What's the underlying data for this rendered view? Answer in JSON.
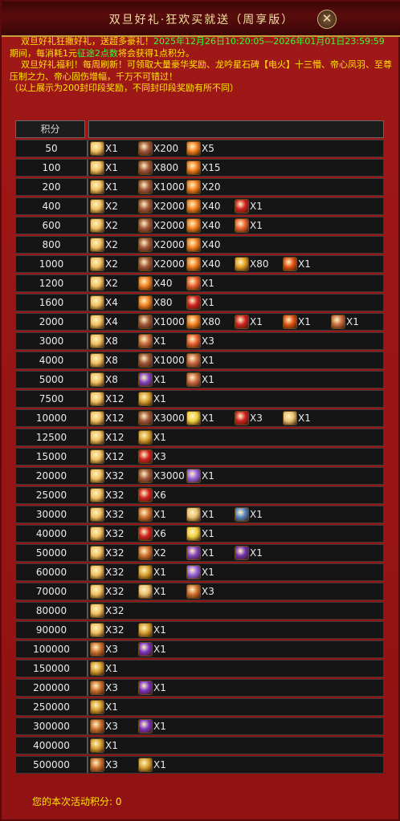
{
  "title": "双旦好礼·狂欢买就送（周享版）",
  "close_label": "✕",
  "description": {
    "line1_a": "双旦好礼狂撒好礼，送超多豪礼！",
    "line1_b": "2025年12月26日10:20:05—2026年01月01日23:59:59",
    "line2_a": "期间，每消耗1元",
    "line2_b": "征途2点数",
    "line2_c": "将会获得1点积分。",
    "line3": "双旦好礼福利！每周刷新！可领取大量豪华奖励、龙吟星石碑【电火】十三懵、帝心凤羽、至尊压制之力、帝心固伤增幅，千万不可错过！",
    "line4": "（以上展示为200封印段奖励，不同封印段奖励有所不同）"
  },
  "table": {
    "header": "积分",
    "rows": [
      {
        "score": "50",
        "items": [
          {
            "icon": "ticket-icon",
            "qty": "X1"
          },
          {
            "icon": "stone-icon",
            "qty": "X200"
          },
          {
            "icon": "feather-icon",
            "qty": "X5"
          }
        ]
      },
      {
        "score": "100",
        "items": [
          {
            "icon": "ticket-icon",
            "qty": "X1"
          },
          {
            "icon": "stone-icon",
            "qty": "X800"
          },
          {
            "icon": "feather-icon",
            "qty": "X15"
          }
        ]
      },
      {
        "score": "200",
        "items": [
          {
            "icon": "ticket-icon",
            "qty": "X1"
          },
          {
            "icon": "stone-icon",
            "qty": "X1000"
          },
          {
            "icon": "feather-icon",
            "qty": "X20"
          }
        ]
      },
      {
        "score": "400",
        "items": [
          {
            "icon": "ticket-icon",
            "qty": "X2"
          },
          {
            "icon": "stone-icon",
            "qty": "X2000"
          },
          {
            "icon": "feather-icon",
            "qty": "X40"
          },
          {
            "icon": "red-box-icon",
            "qty": "X1"
          }
        ]
      },
      {
        "score": "600",
        "items": [
          {
            "icon": "ticket-icon",
            "qty": "X2"
          },
          {
            "icon": "stone-icon",
            "qty": "X2000"
          },
          {
            "icon": "feather-icon",
            "qty": "X40"
          },
          {
            "icon": "gift-icon",
            "qty": "X1"
          }
        ]
      },
      {
        "score": "800",
        "items": [
          {
            "icon": "ticket-icon",
            "qty": "X2"
          },
          {
            "icon": "stone-icon",
            "qty": "X2000"
          },
          {
            "icon": "feather-icon",
            "qty": "X40"
          }
        ]
      },
      {
        "score": "1000",
        "items": [
          {
            "icon": "ticket-icon",
            "qty": "X2"
          },
          {
            "icon": "stone-icon",
            "qty": "X2000"
          },
          {
            "icon": "feather-icon",
            "qty": "X40"
          },
          {
            "icon": "gold-ore-icon",
            "qty": "X80"
          },
          {
            "icon": "fire-orb-icon",
            "qty": "X1"
          }
        ]
      },
      {
        "score": "1200",
        "items": [
          {
            "icon": "ticket-icon",
            "qty": "X2"
          },
          {
            "icon": "feather-icon",
            "qty": "X40"
          },
          {
            "icon": "gift-icon",
            "qty": "X1"
          }
        ]
      },
      {
        "score": "1600",
        "items": [
          {
            "icon": "ticket-icon",
            "qty": "X4"
          },
          {
            "icon": "feather-icon",
            "qty": "X80"
          },
          {
            "icon": "red-box-icon",
            "qty": "X1"
          }
        ]
      },
      {
        "score": "2000",
        "items": [
          {
            "icon": "ticket-icon",
            "qty": "X4"
          },
          {
            "icon": "stone-icon",
            "qty": "X1000"
          },
          {
            "icon": "feather-icon",
            "qty": "X80"
          },
          {
            "icon": "red-box-icon",
            "qty": "X1"
          },
          {
            "icon": "fire-orb-icon",
            "qty": "X1"
          },
          {
            "icon": "medallion-icon",
            "qty": "X1"
          }
        ]
      },
      {
        "score": "3000",
        "items": [
          {
            "icon": "ticket-icon",
            "qty": "X8"
          },
          {
            "icon": "medallion-icon",
            "qty": "X1"
          },
          {
            "icon": "gift-icon",
            "qty": "X3"
          }
        ]
      },
      {
        "score": "4000",
        "items": [
          {
            "icon": "ticket-icon",
            "qty": "X8"
          },
          {
            "icon": "stone-icon",
            "qty": "X1000"
          },
          {
            "icon": "medallion-icon",
            "qty": "X1"
          }
        ]
      },
      {
        "score": "5000",
        "items": [
          {
            "icon": "ticket-icon",
            "qty": "X8"
          },
          {
            "icon": "purple-gift-icon",
            "qty": "X1"
          },
          {
            "icon": "medallion-icon",
            "qty": "X1"
          }
        ]
      },
      {
        "score": "7500",
        "items": [
          {
            "icon": "ticket-icon",
            "qty": "X12"
          },
          {
            "icon": "gold-coin-icon",
            "qty": "X1"
          }
        ]
      },
      {
        "score": "10000",
        "items": [
          {
            "icon": "ticket-icon",
            "qty": "X12"
          },
          {
            "icon": "stone-icon",
            "qty": "X3000"
          },
          {
            "icon": "sparkle-icon",
            "qty": "X1"
          },
          {
            "icon": "red-box-icon",
            "qty": "X3"
          },
          {
            "icon": "treasure-box-icon",
            "qty": "X1"
          }
        ]
      },
      {
        "score": "12500",
        "items": [
          {
            "icon": "ticket-icon",
            "qty": "X12"
          },
          {
            "icon": "gold-coin-icon",
            "qty": "X1"
          }
        ]
      },
      {
        "score": "15000",
        "items": [
          {
            "icon": "ticket-icon",
            "qty": "X12"
          },
          {
            "icon": "red-box-icon",
            "qty": "X3"
          }
        ]
      },
      {
        "score": "20000",
        "items": [
          {
            "icon": "ticket-icon",
            "qty": "X32"
          },
          {
            "icon": "stone-icon",
            "qty": "X3000"
          },
          {
            "icon": "purple-crystal-icon",
            "qty": "X1"
          }
        ]
      },
      {
        "score": "25000",
        "items": [
          {
            "icon": "ticket-icon",
            "qty": "X32"
          },
          {
            "icon": "red-box-icon",
            "qty": "X6"
          }
        ]
      },
      {
        "score": "30000",
        "items": [
          {
            "icon": "ticket-icon",
            "qty": "X32"
          },
          {
            "icon": "scroll-icon",
            "qty": "X1"
          },
          {
            "icon": "treasure-box-icon",
            "qty": "X1"
          },
          {
            "icon": "picture-icon",
            "qty": "X1"
          }
        ]
      },
      {
        "score": "40000",
        "items": [
          {
            "icon": "ticket-icon",
            "qty": "X32"
          },
          {
            "icon": "red-box-icon",
            "qty": "X6"
          },
          {
            "icon": "sparkle-icon",
            "qty": "X1"
          }
        ]
      },
      {
        "score": "50000",
        "items": [
          {
            "icon": "ticket-icon",
            "qty": "X32"
          },
          {
            "icon": "scroll-icon",
            "qty": "X2"
          },
          {
            "icon": "purple-gift-icon",
            "qty": "X1"
          },
          {
            "icon": "purple-card-icon",
            "qty": "X1"
          }
        ]
      },
      {
        "score": "60000",
        "items": [
          {
            "icon": "ticket-icon",
            "qty": "X32"
          },
          {
            "icon": "gold-coin-icon",
            "qty": "X1"
          },
          {
            "icon": "purple-crystal-icon",
            "qty": "X1"
          }
        ]
      },
      {
        "score": "70000",
        "items": [
          {
            "icon": "ticket-icon",
            "qty": "X32"
          },
          {
            "icon": "treasure-box-icon",
            "qty": "X1"
          },
          {
            "icon": "scroll-icon",
            "qty": "X3"
          }
        ]
      },
      {
        "score": "80000",
        "items": [
          {
            "icon": "ticket-icon",
            "qty": "X32"
          }
        ]
      },
      {
        "score": "90000",
        "items": [
          {
            "icon": "ticket-icon",
            "qty": "X32"
          },
          {
            "icon": "gold-coin-icon",
            "qty": "X1"
          }
        ]
      },
      {
        "score": "100000",
        "items": [
          {
            "icon": "scroll-icon",
            "qty": "X3"
          },
          {
            "icon": "purple-orb-icon",
            "qty": "X1"
          }
        ]
      },
      {
        "score": "150000",
        "items": [
          {
            "icon": "gold-coin-icon",
            "qty": "X1"
          }
        ]
      },
      {
        "score": "200000",
        "items": [
          {
            "icon": "scroll-icon",
            "qty": "X3"
          },
          {
            "icon": "purple-orb-icon",
            "qty": "X1"
          }
        ]
      },
      {
        "score": "250000",
        "items": [
          {
            "icon": "gold-coin-icon",
            "qty": "X1"
          }
        ]
      },
      {
        "score": "300000",
        "items": [
          {
            "icon": "scroll-icon",
            "qty": "X3"
          },
          {
            "icon": "purple-orb-icon",
            "qty": "X1"
          }
        ]
      },
      {
        "score": "400000",
        "items": [
          {
            "icon": "gold-coin-icon",
            "qty": "X1"
          }
        ]
      },
      {
        "score": "500000",
        "items": [
          {
            "icon": "scroll-icon",
            "qty": "X3"
          },
          {
            "icon": "gold-coin-icon",
            "qty": "X1"
          }
        ]
      }
    ]
  },
  "footer": {
    "label": "您的本次活动积分:",
    "value": "0"
  },
  "icon_colors": {
    "ticket-icon": "#f0c060",
    "stone-icon": "#a0563a",
    "feather-icon": "#f08020",
    "red-box-icon": "#d02020",
    "gift-icon": "#e86030",
    "gold-ore-icon": "#e0a020",
    "fire-orb-icon": "#e05010",
    "medallion-icon": "#c86a40",
    "purple-gift-icon": "#8040c0",
    "gold-coin-icon": "#d8a030",
    "sparkle-icon": "#f0d040",
    "treasure-box-icon": "#e8c070",
    "purple-crystal-icon": "#9060e0",
    "scroll-icon": "#d07030",
    "picture-icon": "#5080c0",
    "purple-card-icon": "#7030b0",
    "purple-orb-icon": "#7a30c0"
  }
}
